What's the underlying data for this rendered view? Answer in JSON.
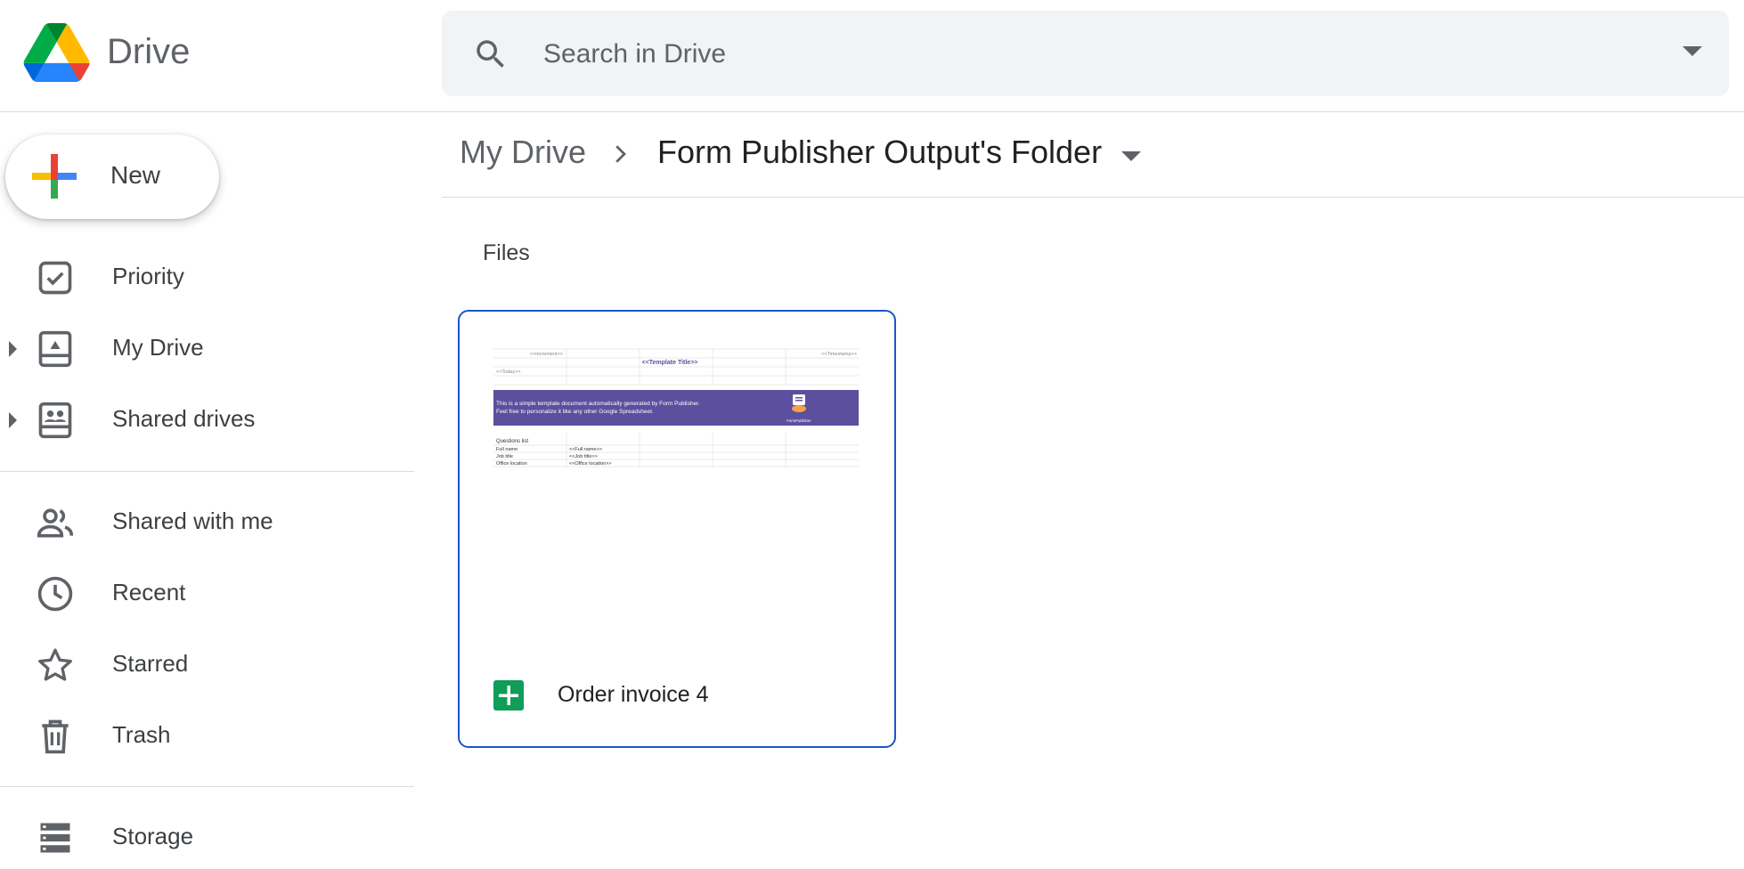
{
  "app": {
    "brand": "Drive"
  },
  "search": {
    "placeholder": "Search in Drive"
  },
  "sidebar": {
    "new_label": "New",
    "items": [
      {
        "label": "Priority"
      },
      {
        "label": "My Drive"
      },
      {
        "label": "Shared drives"
      },
      {
        "label": "Shared with me"
      },
      {
        "label": "Recent"
      },
      {
        "label": "Starred"
      },
      {
        "label": "Trash"
      },
      {
        "label": "Storage"
      }
    ]
  },
  "breadcrumb": {
    "root": "My Drive",
    "current": "Form Publisher Output's Folder"
  },
  "files_section": {
    "title": "Files"
  },
  "files": [
    {
      "name": "Order invoice 4",
      "type_icon": "sheets-icon",
      "thumbnail": {
        "increment": "<<Increment>>",
        "timestamp": "<<Timestamp>>",
        "template_title": "<<Template Title>>",
        "today": "<<Today>>",
        "banner_line1": "This is a simple template document automatically generated by Form Publisher.",
        "banner_line2": "Feel free to personalize it like any other Google Spreadsheet.",
        "banner_logo_text": "FormPublisher",
        "questions_list": "Questions list",
        "rows": [
          {
            "label": "Full name",
            "value": "<<Full name>>"
          },
          {
            "label": "Job title",
            "value": "<<Job title>>"
          },
          {
            "label": "Office location",
            "value": "<<Office location>>"
          }
        ]
      }
    }
  ],
  "colors": {
    "accent_blue": "#1a56c9",
    "banner_purple": "#5b4f9e",
    "sheets_green": "#0f9d58",
    "search_bg": "#f1f3f4"
  }
}
